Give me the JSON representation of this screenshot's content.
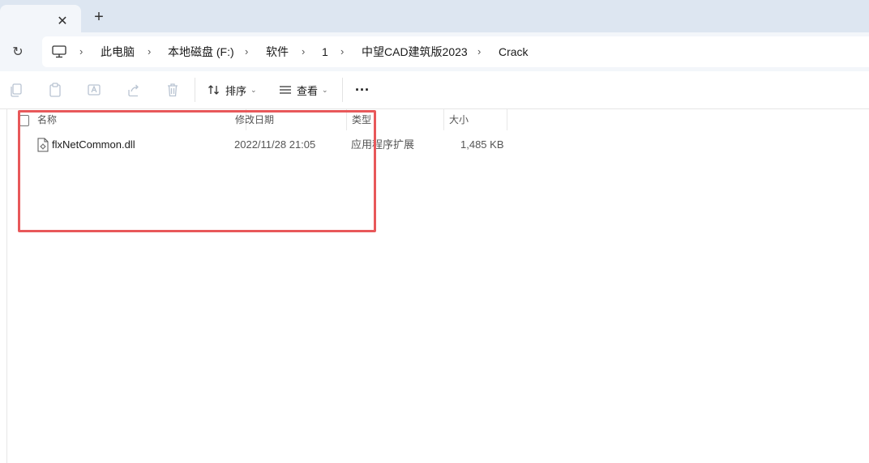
{
  "tabbar": {
    "close_glyph": "✕",
    "new_tab_glyph": "+"
  },
  "navigation": {
    "refresh_glyph": "↻"
  },
  "breadcrumb": [
    "此电脑",
    "本地磁盘 (F:)",
    "软件",
    "1",
    "中望CAD建筑版2023",
    "Crack"
  ],
  "breadcrumb_separator": "›",
  "toolbar": {
    "sort_label": "排序",
    "view_label": "查看",
    "more_glyph": "···",
    "caret_glyph": "⌄"
  },
  "columns": {
    "name": "名称",
    "modified": "修改日期",
    "type": "类型",
    "size": "大小"
  },
  "files": [
    {
      "name": "flxNetCommon.dll",
      "modified": "2022/11/28 21:05",
      "type": "应用程序扩展",
      "size": "1,485 KB"
    }
  ],
  "colors": {
    "highlight_border": "#e8585a",
    "tabbar_bg": "#dde6f1",
    "address_bg": "#f3f6fa"
  },
  "icons": {
    "pc": "computer-icon",
    "file": "dll-file-icon",
    "copy": "copy-icon",
    "paste": "paste-icon",
    "rename": "rename-icon",
    "share": "share-icon",
    "delete": "trash-icon",
    "sort": "sort-arrows-icon",
    "view": "view-lines-icon"
  }
}
